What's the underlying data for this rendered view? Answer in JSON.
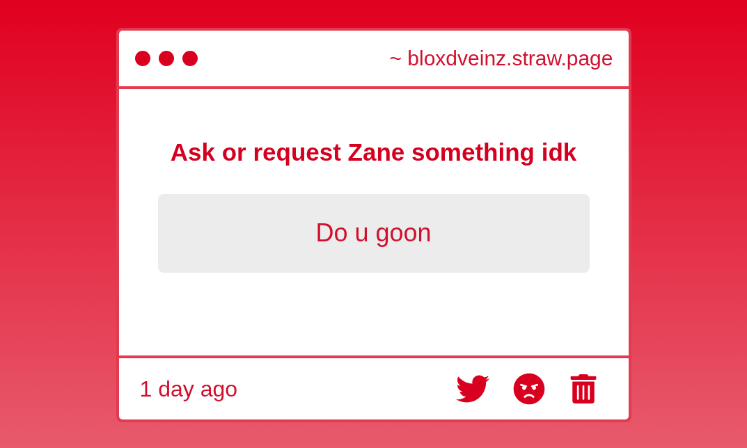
{
  "window": {
    "address": "~ bloxdveinz.straw.page"
  },
  "question": {
    "title": "Ask or request Zane something idk",
    "answer": "Do u goon"
  },
  "footer": {
    "time": "1 day ago"
  }
}
